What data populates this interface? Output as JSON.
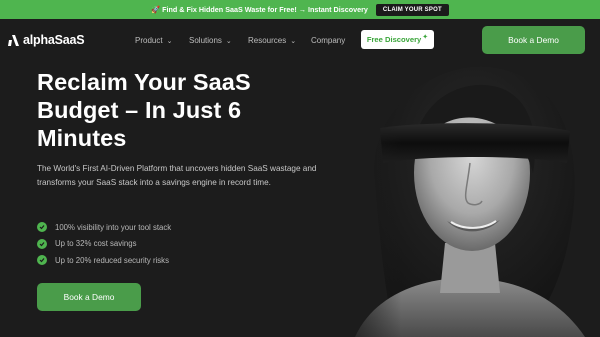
{
  "promo": {
    "text": "🚀 Find & Fix Hidden SaaS Waste for Free! → Instant Discovery",
    "cta": "CLAIM YOUR SPOT"
  },
  "nav": {
    "logo_text": "alphaSaaS",
    "items": [
      {
        "label": "Product",
        "icon": "chevron-down-icon"
      },
      {
        "label": "Solutions",
        "icon": "chevron-down-icon"
      },
      {
        "label": "Resources",
        "icon": "chevron-down-icon"
      },
      {
        "label": "Company"
      }
    ],
    "free_discovery": "Free Discovery",
    "book_demo": "Book a Demo"
  },
  "hero": {
    "title": "Reclaim Your SaaS Budget – In Just 6 Minutes",
    "subtitle": "The World's First AI-Driven Platform that uncovers hidden SaaS wastage and transforms your SaaS stack into a savings engine in record time.",
    "benefits": [
      "100% visibility into your tool stack",
      "Up to 32% cost savings",
      "Up to 20% reduced security risks"
    ],
    "cta": "Book a Demo",
    "image_icon": "blindfolded-woman-photo"
  },
  "colors": {
    "brand_green": "#4fb54f",
    "button_green": "#4a9c4a",
    "background": "#1c1c1c"
  }
}
